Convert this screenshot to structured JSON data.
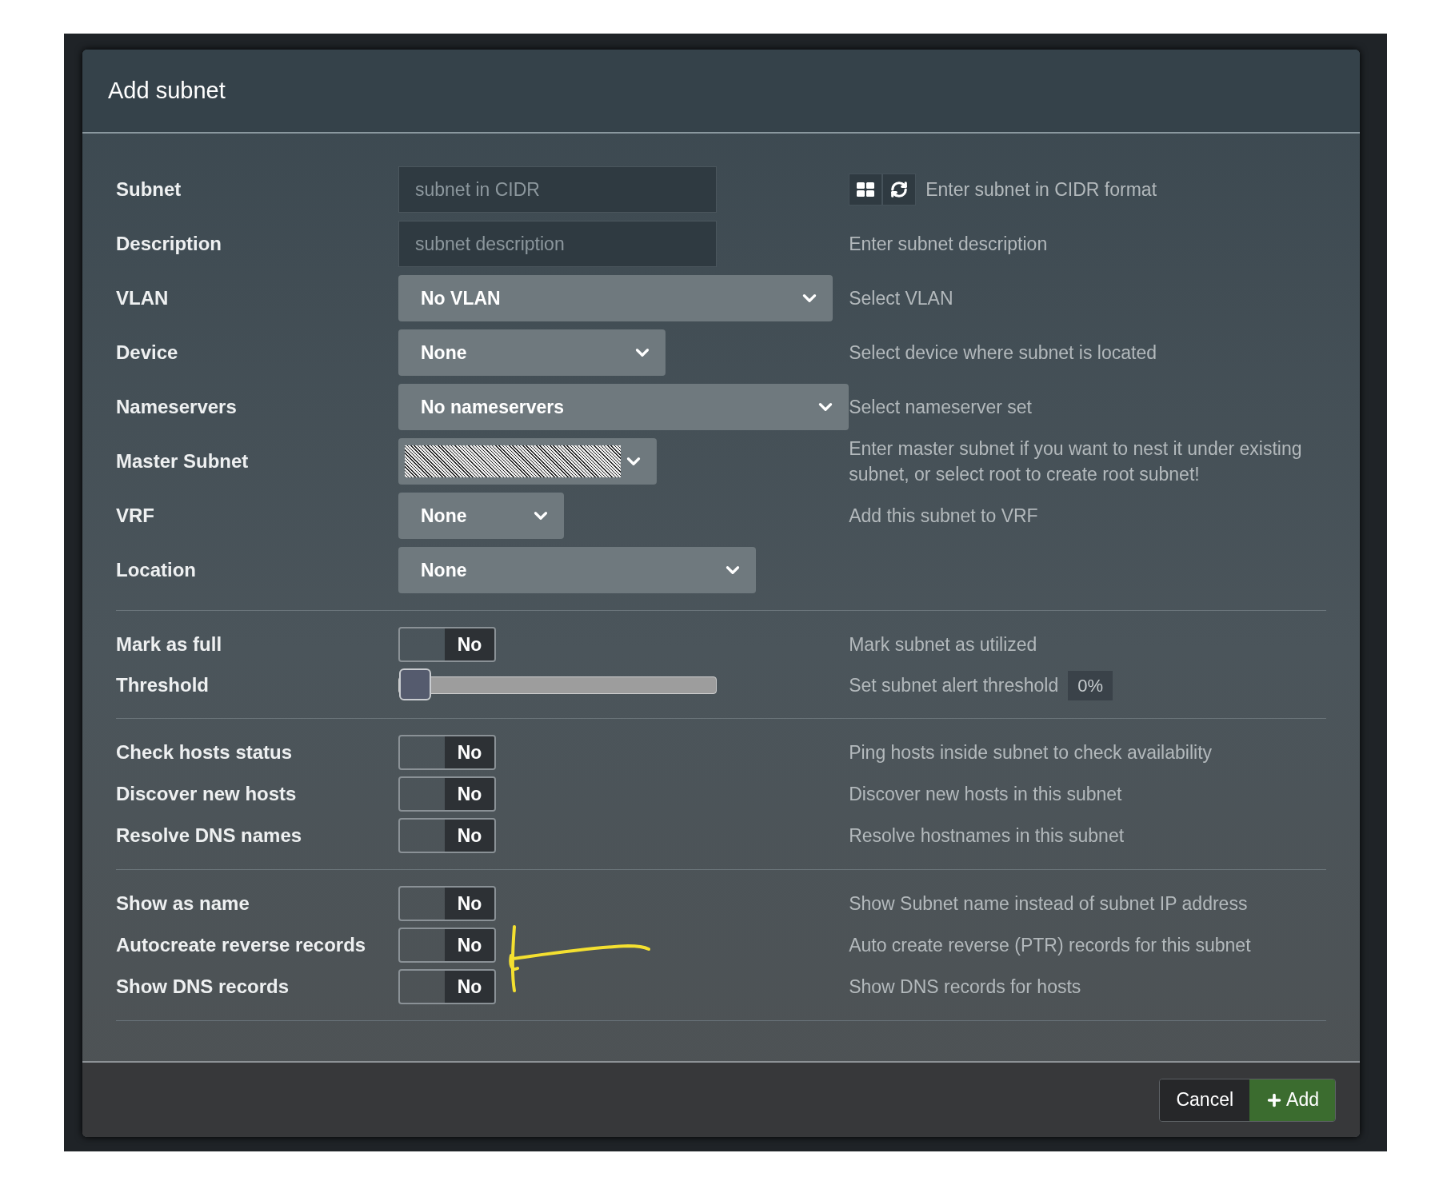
{
  "dialog": {
    "title": "Add subnet"
  },
  "sections": [
    {
      "rows": [
        {
          "kind": "input_tools",
          "label": "Subnet",
          "placeholder": "subnet in CIDR",
          "help": "Enter subnet in CIDR format"
        },
        {
          "kind": "input",
          "label": "Description",
          "placeholder": "subnet description",
          "help": "Enter subnet description"
        },
        {
          "kind": "select",
          "label": "VLAN",
          "value": "No VLAN",
          "help": "Select VLAN"
        },
        {
          "kind": "select",
          "label": "Device",
          "value": "None",
          "help": "Select device where subnet is located"
        },
        {
          "kind": "select",
          "label": "Nameservers",
          "value": "No nameservers",
          "help": "Select nameserver set"
        },
        {
          "kind": "redacted",
          "label": "Master Subnet",
          "help": "Enter master subnet if you want to nest it under existing subnet, or select root to create root subnet!"
        },
        {
          "kind": "select",
          "label": "VRF",
          "value": "None",
          "help": "Add this subnet to VRF"
        },
        {
          "kind": "select",
          "label": "Location",
          "value": "None"
        }
      ]
    },
    {
      "rows": [
        {
          "kind": "switch",
          "label": "Mark as full",
          "on": false,
          "value": "No",
          "help": "Mark subnet as utilized"
        },
        {
          "kind": "slider",
          "label": "Threshold",
          "level": 0,
          "help": "Set subnet alert threshold",
          "reading": "0%"
        }
      ]
    },
    {
      "rows": [
        {
          "kind": "switch",
          "label": "Check hosts status",
          "on": false,
          "value": "No",
          "help": "Ping hosts inside subnet to check availability"
        },
        {
          "kind": "switch",
          "label": "Discover new hosts",
          "on": false,
          "value": "No",
          "help": "Discover new hosts in this subnet"
        },
        {
          "kind": "switch",
          "label": "Resolve DNS names",
          "on": false,
          "value": "No",
          "help": "Resolve hostnames in this subnet"
        }
      ]
    },
    {
      "rows": [
        {
          "kind": "switch",
          "label": "Show as name",
          "on": false,
          "value": "No",
          "help": "Show Subnet name instead of subnet IP address"
        },
        {
          "kind": "switch",
          "label": "Autocreate reverse records",
          "on": false,
          "value": "No",
          "help": "Auto create reverse (PTR) records for this subnet"
        },
        {
          "kind": "switch",
          "label": "Show DNS records",
          "on": false,
          "value": "No",
          "help": "Show DNS records for hosts"
        }
      ]
    }
  ],
  "buttons": [
    {
      "kind": "cancel",
      "label": "Cancel"
    },
    {
      "kind": "add",
      "label": "Add"
    }
  ]
}
